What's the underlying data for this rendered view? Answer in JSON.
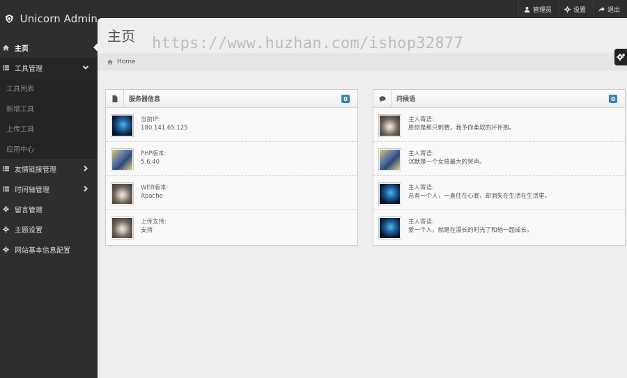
{
  "brand": {
    "name": "Unicorn Admin"
  },
  "topnav": [
    {
      "icon": "user-icon",
      "label": "管理员"
    },
    {
      "icon": "gear-icon",
      "label": "设置"
    },
    {
      "icon": "share-icon",
      "label": "退出"
    }
  ],
  "sidebar": {
    "items": [
      {
        "label": "主页",
        "icon": "home-icon",
        "active": true
      },
      {
        "label": "工具管理",
        "icon": "list-icon",
        "expanded": true
      },
      {
        "label": "工具列表",
        "sub": true
      },
      {
        "label": "新增工具",
        "sub": true
      },
      {
        "label": "上传工具",
        "sub": true
      },
      {
        "label": "应用中心",
        "sub": true
      },
      {
        "label": "友情链接管理",
        "icon": "list-icon",
        "chevron": "right"
      },
      {
        "label": "时间轴管理",
        "icon": "list-icon",
        "chevron": "right"
      },
      {
        "label": "留言管理",
        "icon": "gear-icon"
      },
      {
        "label": "主题设置",
        "icon": "gear-icon"
      },
      {
        "label": "网站基本信息配置",
        "icon": "gear-icon"
      }
    ]
  },
  "page": {
    "title": "主页",
    "watermark": "https://www.huzhan.com/ishop32877",
    "breadcrumb": "Home"
  },
  "server_widget": {
    "title": "服务器信息",
    "badge": "0",
    "rows": [
      {
        "label": "当前IP:",
        "value": "180.141.65.125",
        "avatar": "navi"
      },
      {
        "label": "PHP版本:",
        "value": "5.6.40",
        "avatar": "vault"
      },
      {
        "label": "WEB版本:",
        "value": "Apache",
        "avatar": "raccoon"
      },
      {
        "label": "上传支持:",
        "value": "支持",
        "avatar": "raccoon"
      }
    ]
  },
  "greet_widget": {
    "title": "问候语",
    "badge": "0",
    "rows": [
      {
        "label": "主人寄语:",
        "value": "愿你是那只刺猬，我予你柔软的环怀抱。",
        "avatar": "raccoon"
      },
      {
        "label": "主人寄语:",
        "value": "沉默是一个女孩最大的哭声。",
        "avatar": "vault"
      },
      {
        "label": "主人寄语:",
        "value": "总有一个人，一直住在心底，却消失在生活在生活里。",
        "avatar": "navi"
      },
      {
        "label": "主人寄语:",
        "value": "爱一个人，就是在漫长的时光了和他一起成长。",
        "avatar": "navi"
      }
    ]
  }
}
